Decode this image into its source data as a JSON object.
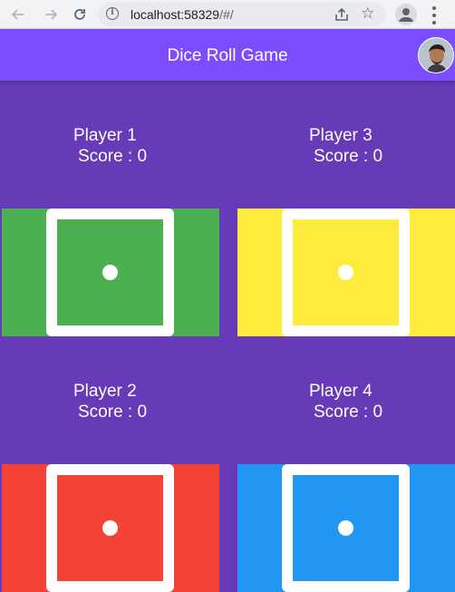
{
  "browser": {
    "url_host": "localhost:58329",
    "url_path": "/#/",
    "icons": [
      "back-icon",
      "forward-icon",
      "reload-icon",
      "info-icon",
      "share-icon",
      "star-icon",
      "profile-icon",
      "menu-icon"
    ]
  },
  "appbar": {
    "title": "Dice Roll Game",
    "color": "#7c4dff"
  },
  "background_color": "#673ab7",
  "players": [
    {
      "name": "Player 1",
      "score": "Score : 0",
      "color": "#4caf50",
      "die_value": 1
    },
    {
      "name": "Player 3",
      "score": "Score : 0",
      "color": "#ffeb3b",
      "die_value": 1
    },
    {
      "name": "Player 2",
      "score": "Score : 0",
      "color": "#f44336",
      "die_value": 1
    },
    {
      "name": "Player 4",
      "score": "Score : 0",
      "color": "#2196f3",
      "die_value": 1
    }
  ]
}
